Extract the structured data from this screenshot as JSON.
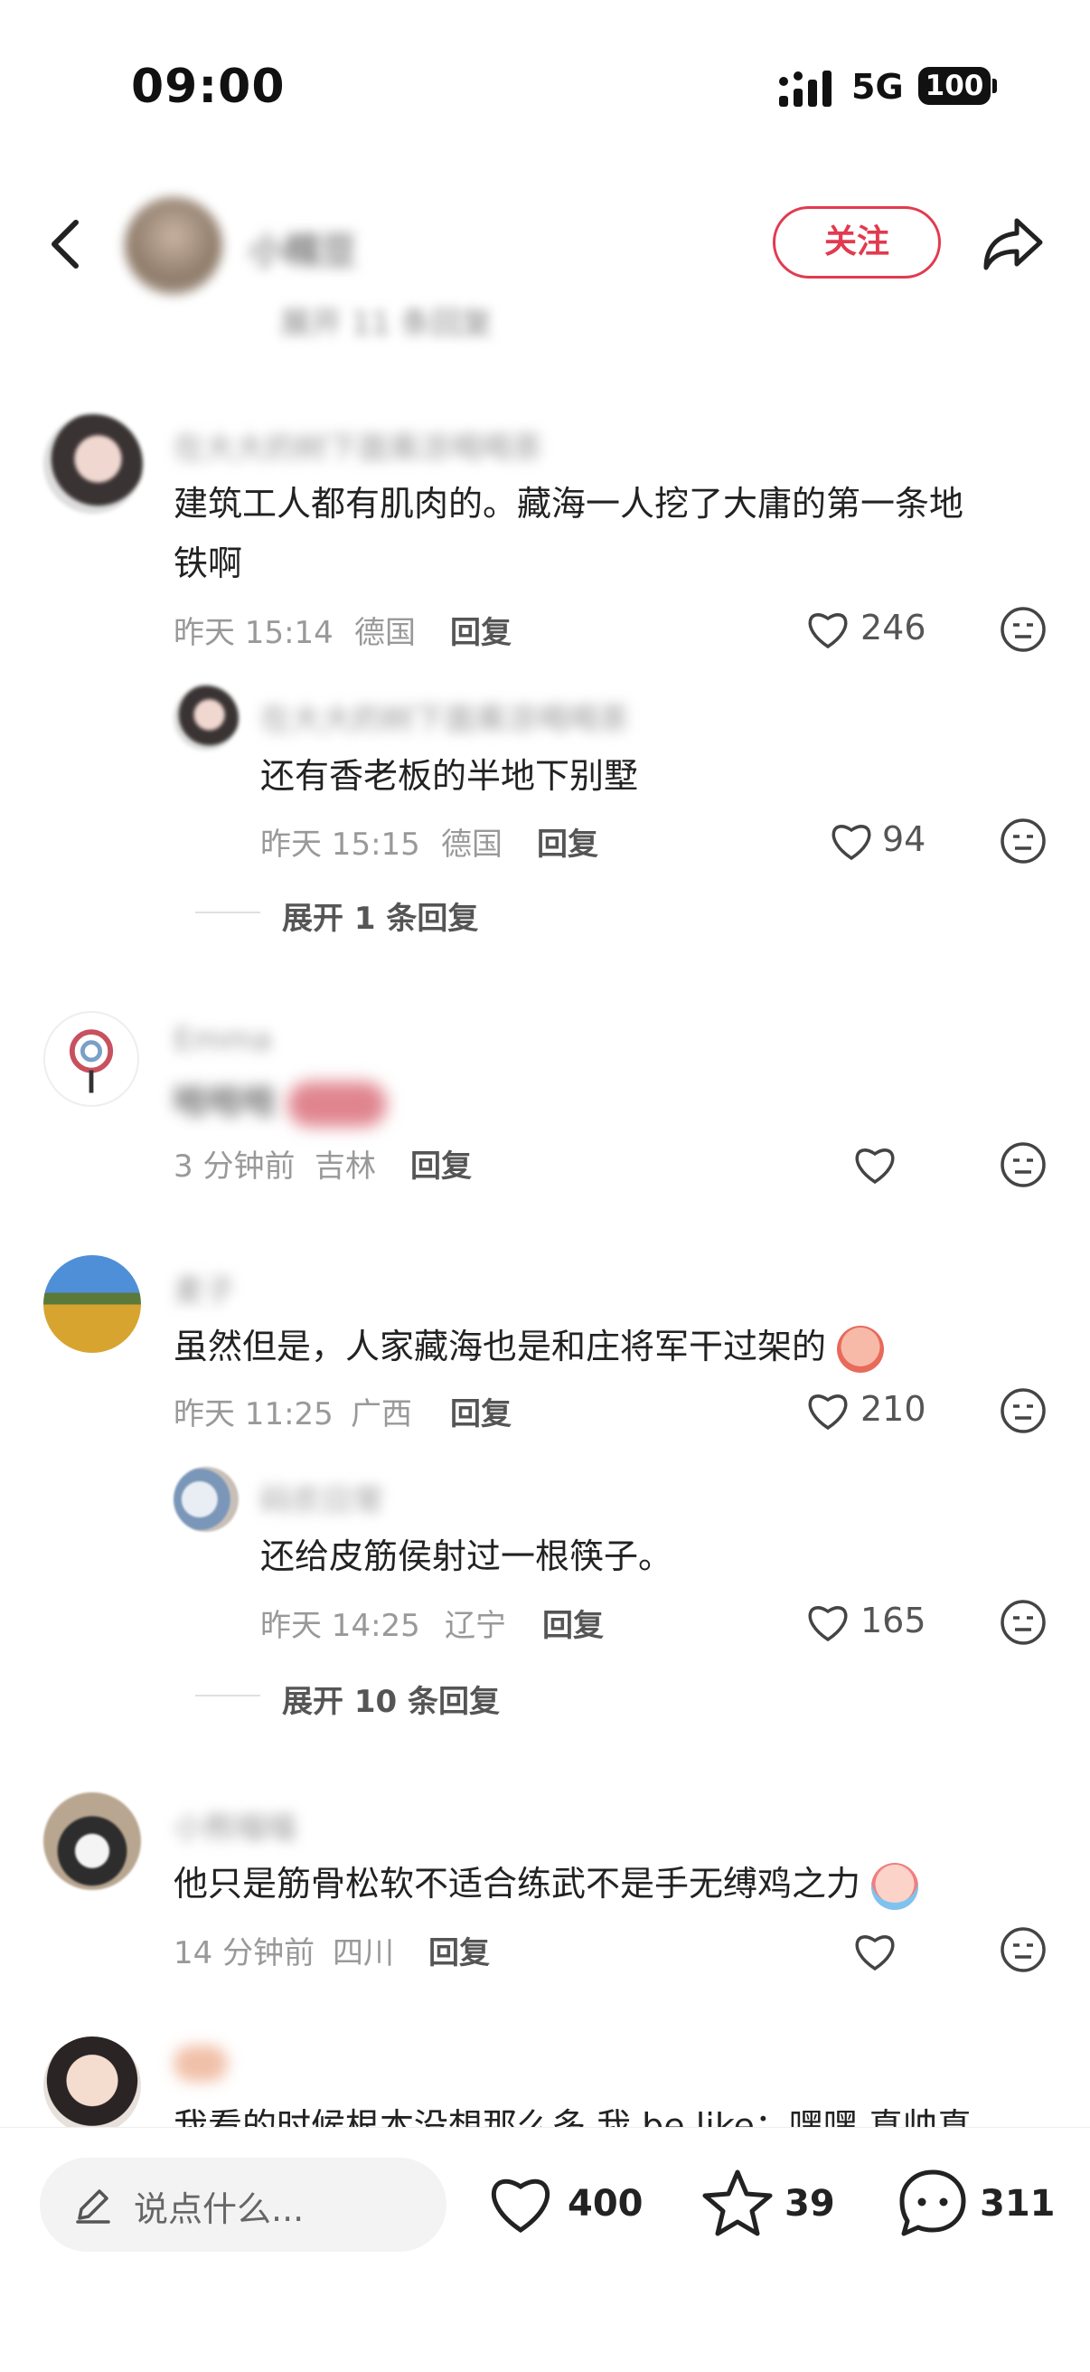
{
  "status_bar": {
    "time": "09:00",
    "network": "5G",
    "battery": "100"
  },
  "header": {
    "username": "小糯豆",
    "follow_label": "关注",
    "hidden_reply_text": "展开 11 条回复"
  },
  "comments": [
    {
      "name": "在大大的树下面乘凉喝喝茶",
      "text_line1": "建筑工人都有肌肉的。藏海一人挖了大庸的第一条地",
      "text_line2": "铁啊",
      "time": "昨天 15:14",
      "location": "德国",
      "reply_label": "回复",
      "likes": "246"
    },
    {
      "name": "在大大的树下面乘凉喝喝茶",
      "text": "还有香老板的半地下别墅",
      "time": "昨天 15:15",
      "location": "德国",
      "reply_label": "回复",
      "likes": "94",
      "expand_label": "展开 1 条回复"
    },
    {
      "name": "Emma",
      "text": "哈哈哈",
      "time": "3 分钟前",
      "location": "吉林",
      "reply_label": "回复",
      "likes": ""
    },
    {
      "name": "麦子",
      "text": "虽然但是，人家藏海也是和庄将军干过架的",
      "time": "昨天 11:25",
      "location": "广西",
      "reply_label": "回复",
      "likes": "210"
    },
    {
      "name": "码农日常",
      "text": "还给皮筋侯射过一根筷子。",
      "time": "昨天 14:25",
      "location": "辽宁",
      "reply_label": "回复",
      "likes": "165",
      "expand_label": "展开 10 条回复"
    },
    {
      "name": "小熊喵喵",
      "text": "他只是筋骨松软不适合练武不是手无缚鸡之力",
      "time": "14 分钟前",
      "location": "四川",
      "reply_label": "回复",
      "likes": ""
    },
    {
      "name": "桃子",
      "text": "我看的时候根本没想那么多 我 be like：嘿嘿 真帅真"
    }
  ],
  "bottom_bar": {
    "input_placeholder": "说点什么...",
    "like_count": "400",
    "star_count": "39",
    "comment_count": "311"
  },
  "colors": {
    "accent": "#e23a4f",
    "muted": "#999999"
  }
}
